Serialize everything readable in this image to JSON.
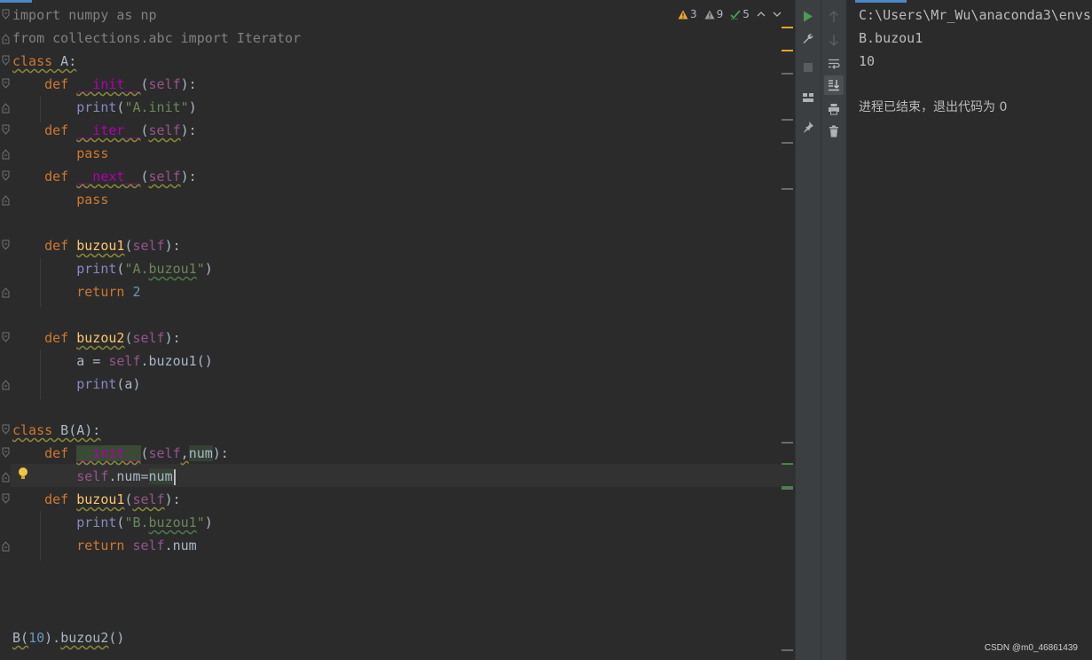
{
  "editor": {
    "inspections": {
      "warnings": "3",
      "weak_warnings": "9",
      "typos": "5"
    },
    "lines": {
      "l1": {
        "a": "import",
        "b": " numpy ",
        "c": "as",
        "d": " np"
      },
      "l2": {
        "a": "from",
        "b": " collections.abc ",
        "c": "import",
        "d": " Iterator"
      },
      "l3": {
        "a": "class",
        "b": " A:"
      },
      "l4": {
        "a": "def",
        "b": "__init__",
        "c": "(",
        "d": "self",
        "e": "):"
      },
      "l5": {
        "a": "print",
        "b": "(",
        "c": "\"A.init\"",
        "d": ")"
      },
      "l6": {
        "a": "def",
        "b": "__iter__",
        "c": "(",
        "d": "self",
        "e": "):"
      },
      "l7": {
        "a": "pass"
      },
      "l8": {
        "a": "def",
        "b": "__next__",
        "c": "(",
        "d": "self",
        "e": "):"
      },
      "l9": {
        "a": "pass"
      },
      "l11": {
        "a": "def",
        "b": "buzou1",
        "c": "(",
        "d": "self",
        "e": "):"
      },
      "l12": {
        "a": "print",
        "b": "(",
        "c": "\"A.",
        "c2": "buzou1",
        "c3": "\"",
        "d": ")"
      },
      "l13": {
        "a": "return",
        "b": "2"
      },
      "l15": {
        "a": "def",
        "b": "buzou2",
        "c": "(",
        "d": "self",
        "e": "):"
      },
      "l16": {
        "a": "a = ",
        "b": "self",
        "c": ".buzou1()"
      },
      "l17": {
        "a": "print",
        "b": "(a)"
      },
      "l19": {
        "a": "class",
        "b": " B(A):"
      },
      "l20": {
        "a": "def",
        "b": "__init__",
        "c": "(",
        "d": "self",
        "e": ",",
        "f": "num",
        "g": "):"
      },
      "l21": {
        "a": "self",
        "b": ".num=",
        "c": "num"
      },
      "l22": {
        "a": "def",
        "b": "buzou1",
        "c": "(",
        "d": "self",
        "e": "):"
      },
      "l23": {
        "a": "print",
        "b": "(",
        "c": "\"B.",
        "c2": "buzou1",
        "c3": "\"",
        "d": ")"
      },
      "l24": {
        "a": "return",
        "b": "self",
        "c": ".num"
      },
      "l28": {
        "a": "B(",
        "b": "10",
        "c": ").",
        "d": "buzou2",
        "e": "()"
      }
    }
  },
  "console": {
    "lines": [
      "C:\\Users\\Mr_Wu\\anaconda3\\envs",
      "B.buzou1",
      "10",
      "进程已结束，退出代码为 0"
    ]
  },
  "watermark": "CSDN @m0_46861439",
  "icons": {
    "run": "run-icon",
    "settings": "wrench-icon",
    "stop": "stop-icon",
    "layout": "layout-icon",
    "pin": "pin-icon",
    "up": "arrow-up-icon",
    "down": "arrow-down-icon",
    "wrap": "soft-wrap-icon",
    "scroll_end": "scroll-to-end-icon",
    "print": "print-icon",
    "trash": "trash-icon"
  },
  "colors": {
    "keyword": "#cc7832",
    "string": "#6a8759",
    "number": "#6897bb",
    "self": "#94558d",
    "dunder": "#b200b2",
    "function": "#ffc66d",
    "builtin": "#8888c6",
    "run_green": "#499c54"
  }
}
